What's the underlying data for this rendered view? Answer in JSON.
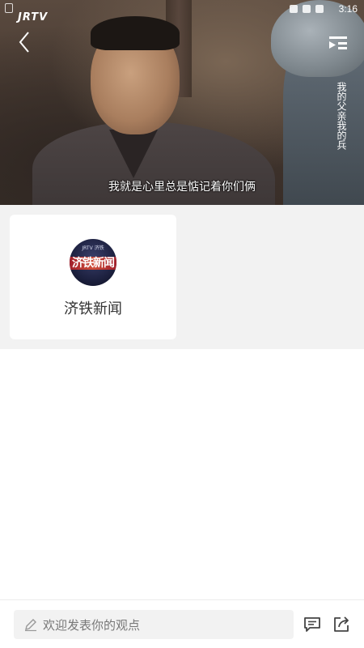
{
  "status_bar": {
    "time": "3:16",
    "logo": "JRTV"
  },
  "video": {
    "subtitle": "我就是心里总是惦记着你们俩",
    "watermark": "我的父亲我的兵",
    "back_icon": "chevron-left-icon",
    "playlist_icon": "playlist-icon"
  },
  "channel_card": {
    "title": "济铁新闻",
    "avatar_text": "济铁新闻",
    "avatar_small_text": "JRTV 济铁"
  },
  "bottom_bar": {
    "comment_placeholder": "欢迎发表你的观点",
    "pencil_icon": "pencil-icon",
    "comment_icon": "comment-icon",
    "share_icon": "share-icon"
  },
  "colors": {
    "page_bg": "#ffffff",
    "section_bg": "#f2f2f2",
    "card_bg": "#ffffff",
    "text_primary": "#333333",
    "placeholder": "#777777"
  }
}
